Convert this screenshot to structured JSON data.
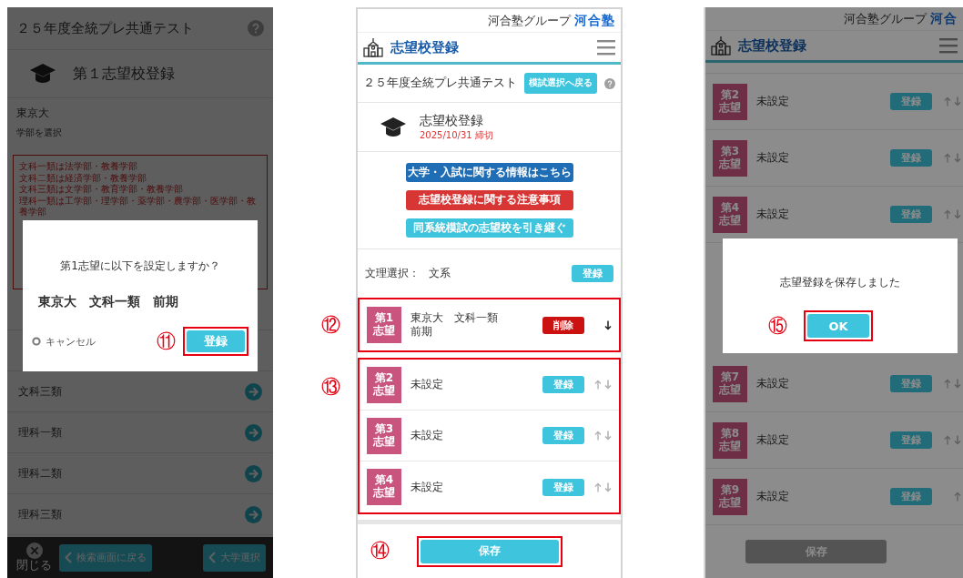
{
  "left_screen": {
    "exam_title": "２５年度全統プレ共通テスト",
    "section_title": "第１志望校登録",
    "university": "東京大",
    "faculty_prompt": "学部を選択",
    "notice_lines": [
      "文科一類は法学部・教養学部",
      "文科二類は経済学部・教養学部",
      "文科三類は文学部・教育学部・教養学部",
      "理科一類は工学部・理学部・薬学部・農学部・医学部・教養学部"
    ],
    "course_rows": [
      "文科三類",
      "理科一類",
      "理科二類",
      "理科三類"
    ],
    "close_label": "閉じる",
    "footer_buttons": [
      "検索画面に戻る",
      "大学選択"
    ],
    "dialog": {
      "message": "第1志望に以下を設定しますか？",
      "selection": "東京大　文科一類　前期",
      "cancel_label": "キャンセル",
      "confirm_label": "登録",
      "annotation": "⑪",
      "highlighted": true
    }
  },
  "middle_screen": {
    "brand_group": "河合塾グループ",
    "brand": "河合塾",
    "page_title": "志望校登録",
    "exam_title": "２５年度全統プレ共通テスト",
    "back_button": "模試選択へ戻る",
    "section_title": "志望校登録",
    "deadline": "2025/10/31 締切",
    "link_buttons": [
      {
        "label": "大学・入試に関する情報はこちら",
        "color": "#1f6db5"
      },
      {
        "label": "志望校登録に関する注意事項",
        "color": "#d83535"
      },
      {
        "label": "同系統模試の志望校を引き継ぐ",
        "color": "#3ec5dd"
      }
    ],
    "track_label": "文理選択：",
    "track_value": "文系",
    "track_button": "登録",
    "choice_groups": [
      {
        "annotation": "⑫",
        "highlighted": true,
        "choices": [
          {
            "rank": "第1",
            "rank_suffix": "志望",
            "lines": [
              "東京大　文科一類",
              "前期"
            ],
            "action": {
              "kind": "delete",
              "label": "削除"
            },
            "move_up": false,
            "move_down": true
          }
        ]
      },
      {
        "annotation": "⑬",
        "highlighted": true,
        "choices": [
          {
            "rank": "第2",
            "rank_suffix": "志望",
            "lines": [
              "未設定"
            ],
            "action": {
              "kind": "register",
              "label": "登録"
            },
            "move_up": true,
            "move_down": true
          },
          {
            "rank": "第3",
            "rank_suffix": "志望",
            "lines": [
              "未設定"
            ],
            "action": {
              "kind": "register",
              "label": "登録"
            },
            "move_up": true,
            "move_down": true
          },
          {
            "rank": "第4",
            "rank_suffix": "志望",
            "lines": [
              "未設定"
            ],
            "action": {
              "kind": "register",
              "label": "登録"
            },
            "move_up": true,
            "move_down": true
          }
        ]
      }
    ],
    "save_button": {
      "label": "保存",
      "disabled": false,
      "highlighted": true,
      "annotation": "⑭"
    }
  },
  "right_screen": {
    "brand_group": "河合塾グループ",
    "brand": "河合",
    "page_title": "志望校登録",
    "choices_above": [
      {
        "rank": "第2",
        "rank_suffix": "志望",
        "lines": [
          "未設定"
        ],
        "action": {
          "kind": "register",
          "label": "登録"
        },
        "move_up": true,
        "move_down": true
      },
      {
        "rank": "第3",
        "rank_suffix": "志望",
        "lines": [
          "未設定"
        ],
        "action": {
          "kind": "register",
          "label": "登録"
        },
        "move_up": true,
        "move_down": true
      },
      {
        "rank": "第4",
        "rank_suffix": "志望",
        "lines": [
          "未設定"
        ],
        "action": {
          "kind": "register",
          "label": "登録"
        },
        "move_up": true,
        "move_down": true
      }
    ],
    "choices_below": [
      {
        "rank": "第7",
        "rank_suffix": "志望",
        "lines": [
          "未設定"
        ],
        "action": {
          "kind": "register",
          "label": "登録"
        },
        "move_up": true,
        "move_down": true
      },
      {
        "rank": "第8",
        "rank_suffix": "志望",
        "lines": [
          "未設定"
        ],
        "action": {
          "kind": "register",
          "label": "登録"
        },
        "move_up": true,
        "move_down": true
      },
      {
        "rank": "第9",
        "rank_suffix": "志望",
        "lines": [
          "未設定"
        ],
        "action": {
          "kind": "register",
          "label": "登録"
        },
        "move_up": true,
        "move_down": false
      }
    ],
    "save_button": {
      "label": "保存",
      "disabled": true
    },
    "dialog": {
      "message": "志望登録を保存しました",
      "ok_label": "OK",
      "annotation": "⑮",
      "highlighted": true
    }
  }
}
